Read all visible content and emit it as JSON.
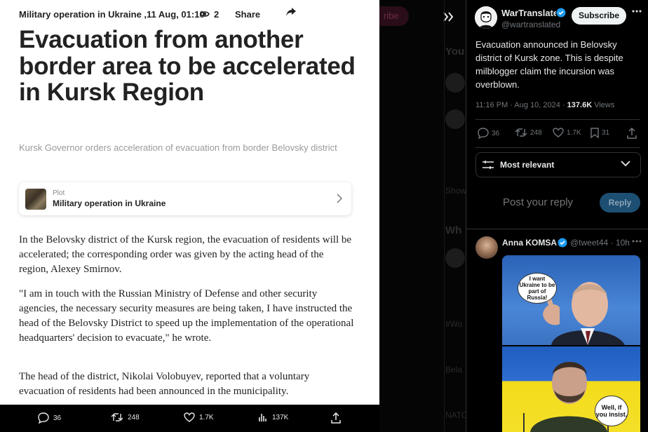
{
  "article": {
    "meta": "Military operation in Ukraine ,11 Aug, 01:10",
    "views": "2",
    "share_label": "Share",
    "headline": "Evacuation from another border area to be accelerated in Kursk Region",
    "subheadline": "Kursk Governor orders acceleration of evacuation from border Belovsky district",
    "plot": {
      "label": "Plot",
      "title": "Military operation in Ukraine"
    },
    "paragraphs": [
      "In the Belovsky district of the Kursk region, the evacuation of residents will be accelerated; the corresponding order was given by the acting head of the region, Alexey Smirnov.",
      "\"I am in touch with the Russian Ministry of Defense and other security agencies, the necessary security measures are being taken, I have instructed the head of the Belovsky District to speed up the implementation of the operational headquarters' decision to evacuate,\" he wrote.",
      "The head of the district, Nikolai Volobuyev, reported that a voluntary evacuation of residents had been announced in the municipality."
    ]
  },
  "statbar": {
    "replies": "36",
    "reposts": "248",
    "likes": "1.7K",
    "views": "137K"
  },
  "background": {
    "subscribe_ghost": "ribe",
    "you_heading": "You",
    "who_heading": "Wh",
    "show_label": "Show",
    "tag": "#Wo",
    "bela": "Bela",
    "nato": "NATO"
  },
  "tweet": {
    "name": "WarTranslated",
    "handle": "@wartranslated",
    "subscribe_label": "Subscribe",
    "text": "Evacuation announced in Belovsky district of Kursk zone. This is despite milblogger claim the incursion was overblown.",
    "time": "11:16 PM · Aug 10, 2024 · ",
    "views_count": "137.6K",
    "views_label": " Views",
    "replies": "36",
    "reposts": "248",
    "likes": "1.7K",
    "bookmarks": "31",
    "sort_label": "Most relevant",
    "reply_placeholder": "Post your reply",
    "reply_button": "Reply"
  },
  "reply": {
    "name": "Anna KOMSA",
    "handle": "@tweet44",
    "age": "· 10h",
    "meme_top_text": "I want Ukraine to be part of Russia!",
    "meme_bottom_text": "Well, if you insist."
  },
  "colors": {
    "x_blue": "#1d9bf0",
    "reply_btn_bg": "#1d4f73",
    "article_text": "#222222"
  }
}
